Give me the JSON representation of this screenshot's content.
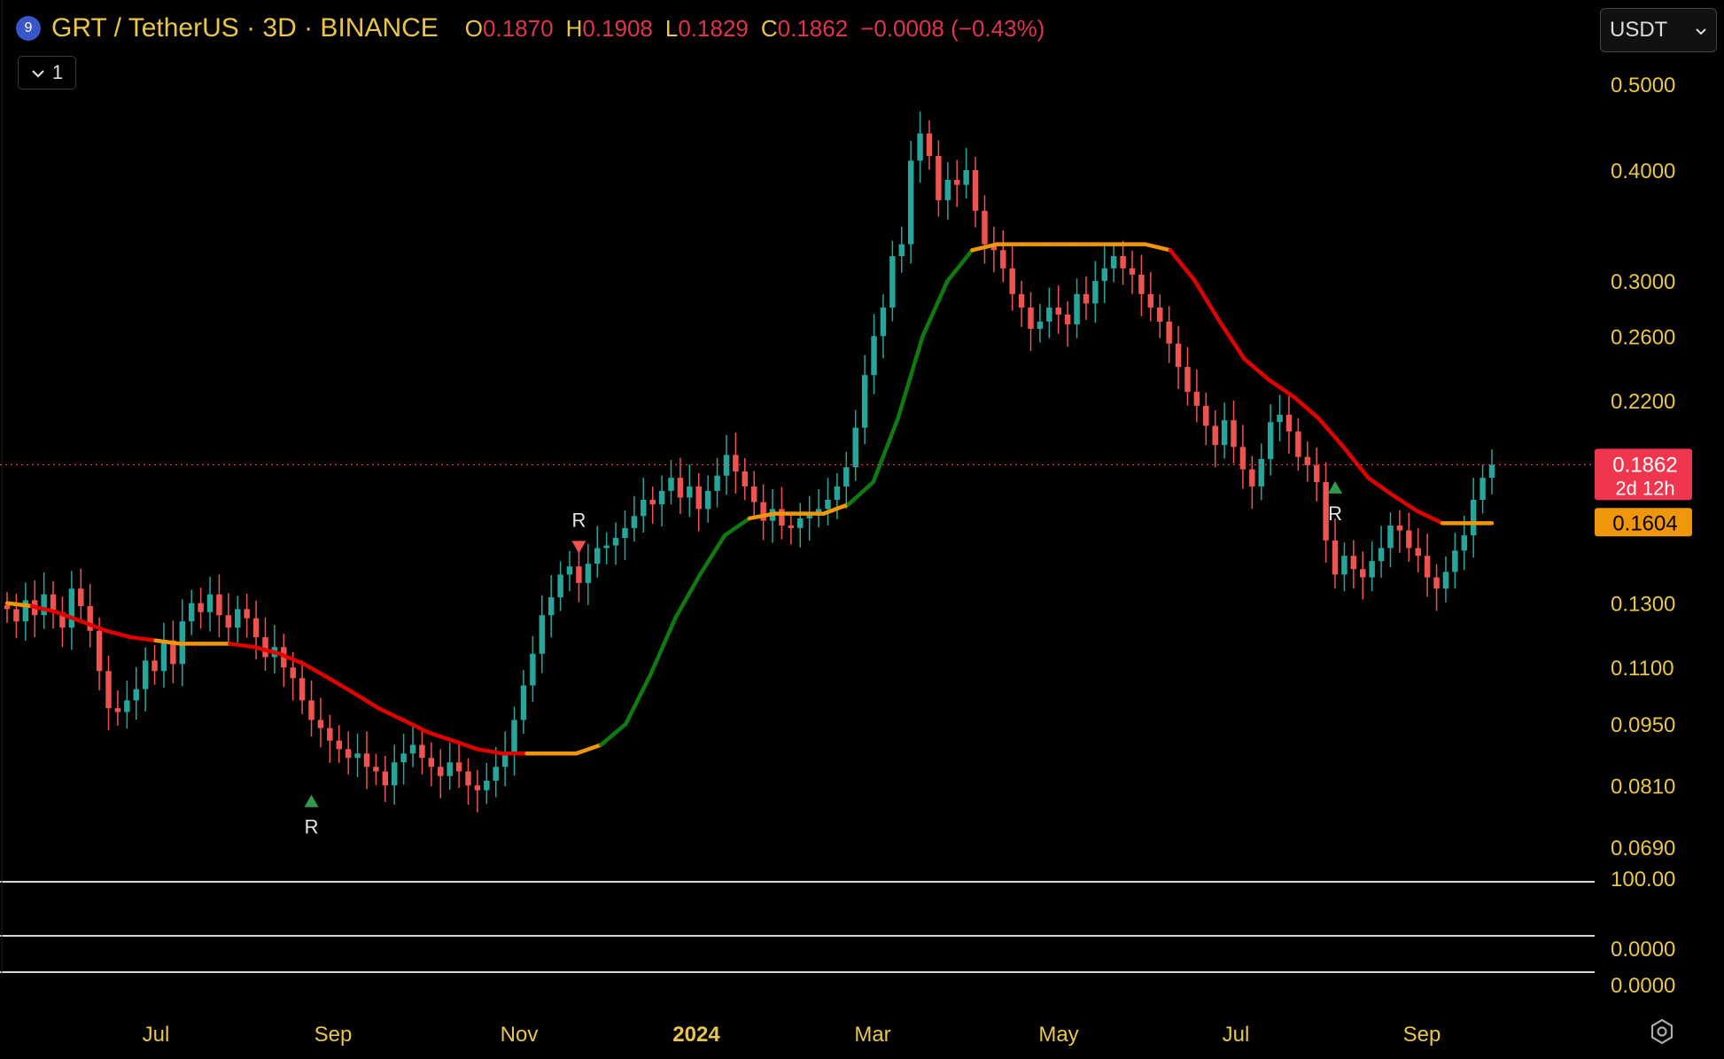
{
  "header": {
    "badge": "9",
    "title": "GRT / TetherUS · 3D · BINANCE",
    "o_key": "O",
    "o_val": "0.1870",
    "h_key": "H",
    "h_val": "0.1908",
    "l_key": "L",
    "l_val": "0.1829",
    "c_key": "C",
    "c_val": "0.1862",
    "change": "−0.0008 (−0.43%)"
  },
  "indicator_toggle": {
    "icon": "chevron-down-icon",
    "count": "1"
  },
  "currency_select": {
    "value": "USDT",
    "icon": "chevron-down-icon"
  },
  "colors": {
    "up": "#26a69a",
    "down": "#ef5350",
    "line_bear": "#e10000",
    "line_bull": "#0f7a0f",
    "line_flat": "#f0960a",
    "axis_text": "#e8c64a",
    "price_tag": "#f0364f",
    "level_tag": "#f0960a"
  },
  "chart_data": {
    "type": "candlestick",
    "scale": "log",
    "y_ticks": [
      "0.5000",
      "0.4000",
      "0.3000",
      "0.2600",
      "0.2200",
      "0.1862",
      "0.1604",
      "0.1300",
      "0.1100",
      "0.0950",
      "0.0810",
      "0.0690"
    ],
    "x_ticks": [
      "Jul",
      "Sep",
      "Nov",
      "2024",
      "Mar",
      "May",
      "Jul",
      "Sep"
    ],
    "subpanes": [
      {
        "tick": "100.00"
      },
      {
        "tick": "0.0000"
      },
      {
        "tick": "0.0000"
      }
    ],
    "last_price": {
      "value": 0.1862,
      "label": "0.1862",
      "countdown": "2d 12h"
    },
    "level": {
      "value": 0.1604,
      "label": "0.1604"
    },
    "closes": [
      0.128,
      0.124,
      0.131,
      0.126,
      0.133,
      0.127,
      0.122,
      0.135,
      0.129,
      0.121,
      0.109,
      0.099,
      0.098,
      0.101,
      0.104,
      0.112,
      0.109,
      0.118,
      0.111,
      0.124,
      0.13,
      0.127,
      0.133,
      0.126,
      0.122,
      0.128,
      0.125,
      0.119,
      0.113,
      0.116,
      0.11,
      0.107,
      0.101,
      0.096,
      0.094,
      0.091,
      0.089,
      0.087,
      0.088,
      0.085,
      0.084,
      0.081,
      0.086,
      0.088,
      0.09,
      0.087,
      0.085,
      0.083,
      0.086,
      0.084,
      0.081,
      0.08,
      0.082,
      0.085,
      0.088,
      0.096,
      0.105,
      0.114,
      0.126,
      0.132,
      0.14,
      0.143,
      0.137,
      0.144,
      0.15,
      0.151,
      0.154,
      0.158,
      0.163,
      0.17,
      0.168,
      0.174,
      0.18,
      0.171,
      0.176,
      0.166,
      0.174,
      0.181,
      0.191,
      0.183,
      0.176,
      0.169,
      0.161,
      0.166,
      0.159,
      0.158,
      0.162,
      0.164,
      0.166,
      0.17,
      0.176,
      0.185,
      0.205,
      0.235,
      0.26,
      0.28,
      0.32,
      0.33,
      0.41,
      0.44,
      0.415,
      0.37,
      0.39,
      0.385,
      0.4,
      0.36,
      0.33,
      0.325,
      0.31,
      0.29,
      0.28,
      0.265,
      0.27,
      0.28,
      0.275,
      0.268,
      0.29,
      0.283,
      0.3,
      0.31,
      0.32,
      0.31,
      0.305,
      0.29,
      0.28,
      0.27,
      0.255,
      0.24,
      0.225,
      0.217,
      0.206,
      0.196,
      0.209,
      0.195,
      0.184,
      0.176,
      0.189,
      0.208,
      0.212,
      0.203,
      0.19,
      0.186,
      0.178,
      0.153,
      0.14,
      0.147,
      0.142,
      0.139,
      0.145,
      0.15,
      0.159,
      0.157,
      0.15,
      0.147,
      0.139,
      0.135,
      0.141,
      0.149,
      0.155,
      0.17,
      0.18,
      0.1862
    ],
    "trend_line": [
      0.13,
      0.129,
      0.127,
      0.124,
      0.121,
      0.119,
      0.118,
      0.117,
      0.117,
      0.117,
      0.116,
      0.114,
      0.111,
      0.107,
      0.103,
      0.099,
      0.096,
      0.093,
      0.091,
      0.089,
      0.088,
      0.088,
      0.088,
      0.088,
      0.09,
      0.095,
      0.108,
      0.125,
      0.14,
      0.155,
      0.162,
      0.164,
      0.164,
      0.164,
      0.168,
      0.178,
      0.21,
      0.26,
      0.3,
      0.325,
      0.33,
      0.33,
      0.33,
      0.33,
      0.33,
      0.33,
      0.33,
      0.325,
      0.3,
      0.27,
      0.245,
      0.232,
      0.222,
      0.21,
      0.195,
      0.18,
      0.172,
      0.165,
      0.16,
      0.16,
      0.16
    ],
    "trend_state": [
      "flat",
      "bear",
      "bear",
      "bear",
      "bear",
      "bear",
      "flat",
      "flat",
      "flat",
      "bear",
      "bear",
      "bear",
      "bear",
      "bear",
      "bear",
      "bear",
      "bear",
      "bear",
      "bear",
      "bear",
      "bear",
      "flat",
      "flat",
      "flat",
      "bull",
      "bull",
      "bull",
      "bull",
      "bull",
      "bull",
      "flat",
      "flat",
      "flat",
      "flat",
      "bull",
      "bull",
      "bull",
      "bull",
      "bull",
      "flat",
      "flat",
      "flat",
      "flat",
      "flat",
      "flat",
      "flat",
      "flat",
      "bear",
      "bear",
      "bear",
      "bear",
      "bear",
      "bear",
      "bear",
      "bear",
      "bear",
      "bear",
      "bear",
      "flat",
      "flat",
      "flat"
    ],
    "signals": [
      {
        "label": "R",
        "price": 0.078,
        "dir": "up",
        "idx": 33
      },
      {
        "label": "R",
        "price": 0.15,
        "dir": "down",
        "idx": 62
      },
      {
        "label": "R",
        "price": 0.176,
        "dir": "up",
        "idx": 144
      }
    ]
  }
}
